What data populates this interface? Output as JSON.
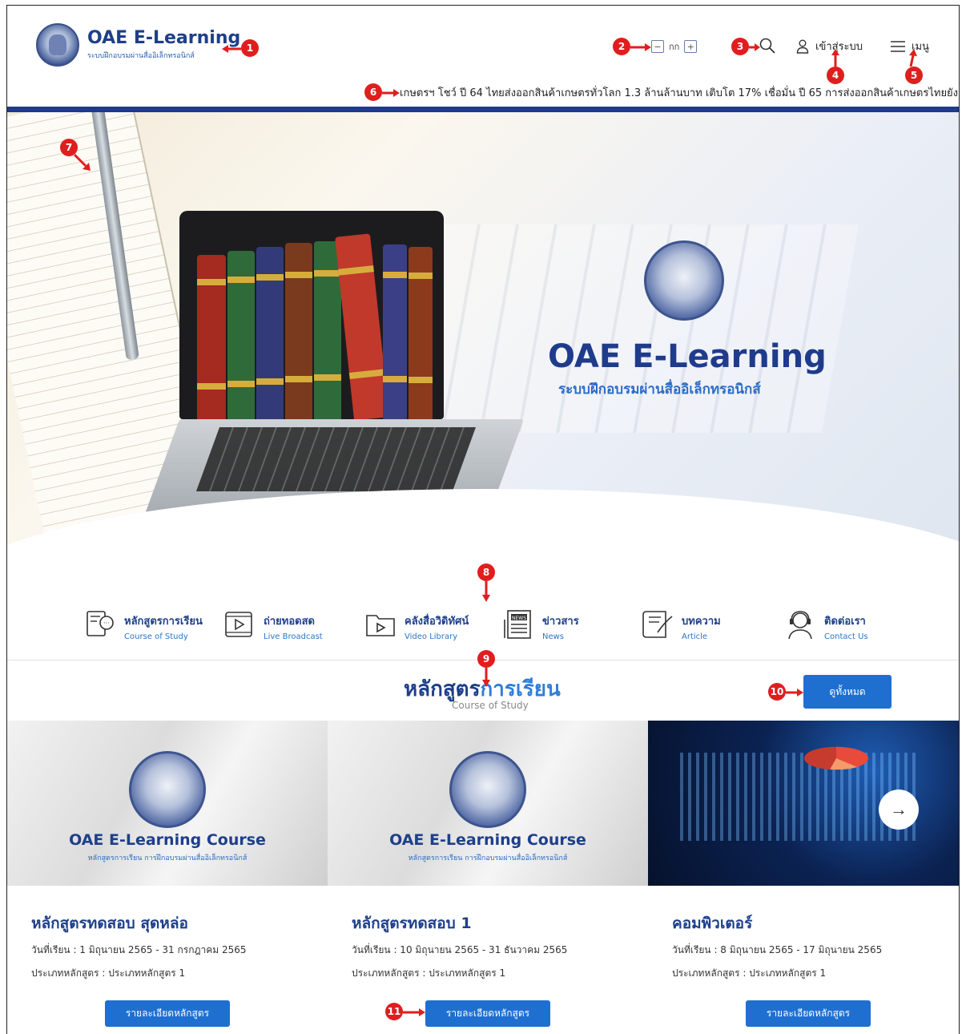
{
  "brand": {
    "title": "OAE E-Learning",
    "subtitle": "ระบบฝึกอบรมผ่านสื่ออิเล็กทรอนิกส์"
  },
  "header": {
    "font_size_label": "กก",
    "font_decrease": "−",
    "font_increase": "+",
    "login_label": "เข้าสู่ระบบ",
    "menu_label": "เมนู",
    "ticker_text": "เกษตรฯ โชว์ ปี 64 ไทยส่งออกสินค้าเกษตรทั่วโลก 1.3 ล้านล้านบาท เติบโต 17% เชื่อมั่น ปี 65 การส่งออกสินค้าเกษตรไทยยังสดใ"
  },
  "hero": {
    "title": "OAE E-Learning",
    "subtitle": "ระบบฝึกอบรมผ่านสื่ออิเล็กทรอนิกส์"
  },
  "quick_links": [
    {
      "th": "หลักสูตรการเรียน",
      "en": "Course of Study",
      "icon": "course-book-icon"
    },
    {
      "th": "ถ่ายทอดสด",
      "en": "Live Broadcast",
      "icon": "live-play-icon"
    },
    {
      "th": "คลังสื่อวิดิทัศน์",
      "en": "Video Library",
      "icon": "video-folder-icon"
    },
    {
      "th": "ข่าวสาร",
      "en": "News",
      "icon": "news-icon"
    },
    {
      "th": "บทความ",
      "en": "Article",
      "icon": "article-icon"
    },
    {
      "th": "ติดต่อเรา",
      "en": "Contact Us",
      "icon": "headset-icon"
    }
  ],
  "courses_section": {
    "title_part1": "หลักสูตร",
    "title_part2": "การเรียน",
    "subtitle": "Course of Study",
    "view_all": "ดูทั้งหมด"
  },
  "courses": [
    {
      "image_title": "OAE E-Learning Course",
      "image_sub": "หลักสูตรการเรียน การฝึกอบรมผ่านสื่ออิเล็กทรอนิกส์",
      "name": "หลักสูตรทดสอบ สุดหล่อ",
      "date": "วันที่เรียน : 1 มิถุนายน 2565 - 31 กรกฎาคม 2565",
      "type": "ประเภทหลักสูตร : ประเภทหลักสูตร 1",
      "button": "รายละเอียดหลักสูตร"
    },
    {
      "image_title": "OAE E-Learning Course",
      "image_sub": "หลักสูตรการเรียน การฝึกอบรมผ่านสื่ออิเล็กทรอนิกส์",
      "name": "หลักสูตรทดสอบ 1",
      "date": "วันที่เรียน : 10 มิถุนายน 2565 - 31 ธันวาคม 2565",
      "type": "ประเภทหลักสูตร : ประเภทหลักสูตร 1",
      "button": "รายละเอียดหลักสูตร"
    },
    {
      "name": "คอมพิวเตอร์",
      "date": "วันที่เรียน : 8 มิถุนายน 2565 - 17 มิถุนายน 2565",
      "type": "ประเภทหลักสูตร : ประเภทหลักสูตร 1",
      "button": "รายละเอียดหลักสูตร",
      "next_icon": "→"
    }
  ],
  "annotations": [
    "1",
    "2",
    "3",
    "4",
    "5",
    "6",
    "7",
    "8",
    "9",
    "10",
    "11"
  ],
  "colors": {
    "brand_navy": "#1e3f8a",
    "accent_blue": "#2f7fd8",
    "button_blue": "#1f6fd1",
    "rule_blue": "#1f3a8c",
    "annotation_red": "#e01e1e"
  }
}
